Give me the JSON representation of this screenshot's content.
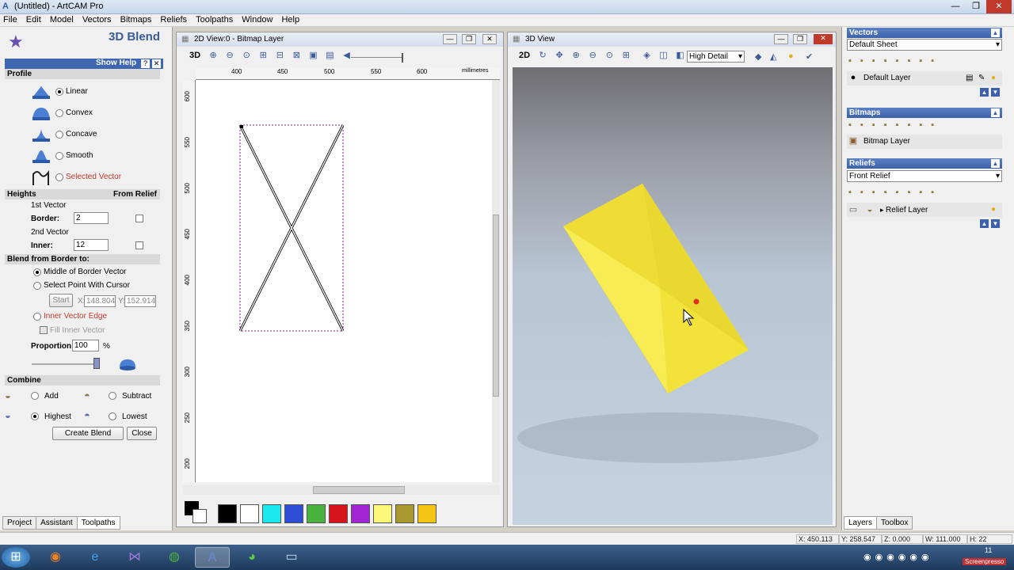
{
  "app": {
    "title": "(Untitled) - ArtCAM Pro"
  },
  "menu": [
    "File",
    "Edit",
    "Model",
    "Vectors",
    "Bitmaps",
    "Reliefs",
    "Toolpaths",
    "Window",
    "Help"
  ],
  "left": {
    "title": "3D Blend",
    "show_help": "Show Help",
    "profile_head": "Profile",
    "profiles": [
      {
        "label": "Linear",
        "selected": true
      },
      {
        "label": "Convex",
        "selected": false
      },
      {
        "label": "Concave",
        "selected": false
      },
      {
        "label": "Smooth",
        "selected": false
      },
      {
        "label": "Selected Vector",
        "selected": false
      }
    ],
    "heights_head": "Heights",
    "from_relief": "From Relief",
    "first_vector": "1st Vector",
    "border_label": "Border:",
    "border_value": "2",
    "second_vector": "2nd Vector",
    "inner_label": "Inner:",
    "inner_value": "12",
    "blend_head": "Blend from Border to:",
    "middle_border": "Middle of Border Vector",
    "select_point": "Select Point With Cursor",
    "start_btn": "Start",
    "x_label": "X:",
    "x_value": "148.804",
    "y_label": "Y:",
    "y_value": "152.914",
    "inner_edge": "Inner Vector Edge",
    "fill_inner": "Fill Inner Vector",
    "proportion_label": "Proportion:",
    "proportion_value": "100",
    "percent": "%",
    "combine_head": "Combine",
    "add": "Add",
    "subtract": "Subtract",
    "highest": "Highest",
    "lowest": "Lowest",
    "create_btn": "Create Blend",
    "close_btn": "Close",
    "tabs": [
      "Project",
      "Assistant",
      "Toolpaths"
    ]
  },
  "view2d": {
    "title": "2D View:0 - Bitmap Layer",
    "mode": "3D",
    "ruler_h": [
      "400",
      "450",
      "500",
      "550",
      "600"
    ],
    "ruler_unit": "millimetres",
    "ruler_v": [
      "600",
      "550",
      "500",
      "450",
      "400",
      "350",
      "300",
      "250",
      "200"
    ],
    "swatches": [
      "#000000",
      "#ffffff",
      "#19e8ee",
      "#2f4ed6",
      "#4ab33f",
      "#d6141c",
      "#a125d2",
      "#fdf87c",
      "#a89a2e",
      "#f4c515"
    ]
  },
  "view3d": {
    "title": "3D View",
    "mode": "2D",
    "detail": "High Detail"
  },
  "right": {
    "vectors_head": "Vectors",
    "vectors_sheet": "Default Sheet",
    "default_layer": "Default Layer",
    "bitmaps_head": "Bitmaps",
    "bitmap_layer": "Bitmap Layer",
    "reliefs_head": "Reliefs",
    "relief_select": "Front Relief",
    "relief_layer": "Relief Layer",
    "tabs": [
      "Layers",
      "Toolbox"
    ]
  },
  "status": {
    "x": "X: 450.113",
    "y": "Y: 258.547",
    "z": "Z: 0.000",
    "w": "W: 111.000",
    "h": "H: 22"
  },
  "taskbar": {
    "clock": "11",
    "brand": "Screenpresso"
  }
}
